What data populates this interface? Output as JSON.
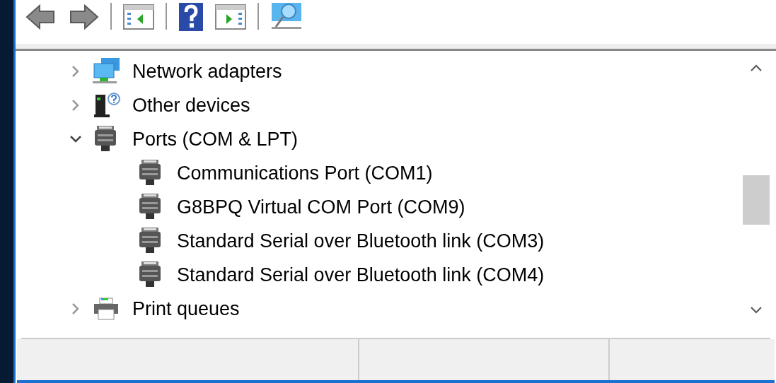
{
  "tree": {
    "items": [
      {
        "label": "Network adapters",
        "expanded": false
      },
      {
        "label": "Other devices",
        "expanded": false
      },
      {
        "label": "Ports (COM & LPT)",
        "expanded": true,
        "children": [
          {
            "label": "Communications Port (COM1)"
          },
          {
            "label": "G8BPQ Virtual COM Port (COM9)"
          },
          {
            "label": "Standard Serial over Bluetooth link (COM3)"
          },
          {
            "label": "Standard Serial over Bluetooth link (COM4)"
          }
        ]
      },
      {
        "label": "Print queues",
        "expanded": false
      }
    ]
  }
}
